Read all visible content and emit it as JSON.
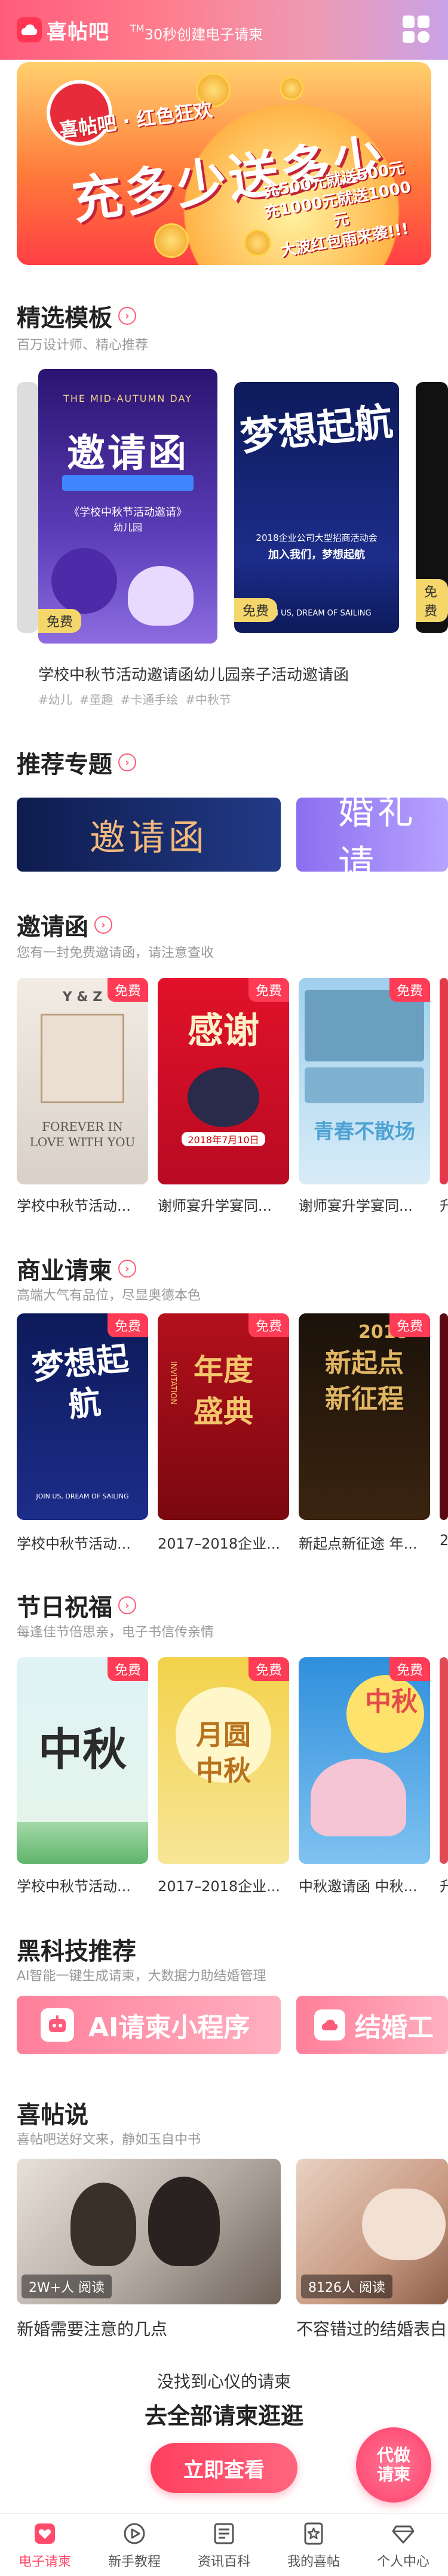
{
  "header": {
    "app_name": "喜帖吧",
    "slogan": "30秒创建电子请柬"
  },
  "banner": {
    "small_title": "喜帖吧 · 红色狂欢",
    "big_title": "充多少送多少",
    "promo_lines": [
      "充500元就送500元",
      "充1000元就送1000元",
      "大波红包雨来袭!!!"
    ]
  },
  "featured": {
    "title": "精选模板",
    "subtitle": "百万设计师、精心推荐",
    "free_label": "免费",
    "card1": {
      "heading": "THE MID-AUTUMN DAY",
      "title": "邀请函",
      "line": "《学校中秋节活动邀请》",
      "small": "幼儿园"
    },
    "card2": {
      "title": "梦想起航",
      "line": "2018企业公司大型招商活动会",
      "small": "加入我们，梦想起航",
      "footer": "JOIN US, DREAM OF SAILING"
    },
    "caption": "学校中秋节活动邀请函幼儿园亲子活动邀请函",
    "tags": [
      "#幼儿",
      "#童趣",
      "#卡通手绘",
      "#中秋节"
    ]
  },
  "topics": {
    "title": "推荐专题",
    "items": [
      "邀请函",
      "婚礼请"
    ]
  },
  "invitations": {
    "title": "邀请函",
    "subtitle": "您有一封免费邀请函，请注意查收",
    "free_label": "免费",
    "cards": [
      {
        "caption": "学校中秋节活动...",
        "art": "FOREVER IN LOVE WITH YOU",
        "top": "Y & Z"
      },
      {
        "caption": "谢师宴升学宴同...",
        "art": "感谢",
        "date": "2018年7月10日"
      },
      {
        "caption": "谢师宴升学宴同...",
        "art": "青春不散场"
      },
      {
        "caption": "升"
      }
    ]
  },
  "business": {
    "title": "商业请柬",
    "subtitle": "高端大气有品位，尽显奥德本色",
    "free_label": "免费",
    "cards": [
      {
        "caption": "学校中秋节活动...",
        "art": "梦想起航",
        "footer": "JOIN US, DREAM OF SAILING"
      },
      {
        "caption": "2017–2018企业...",
        "art": "年度盛典",
        "side": "INVITATION"
      },
      {
        "caption": "新起点新征途 年...",
        "art": "新起点新征程",
        "year": "2018"
      },
      {
        "caption": "2"
      }
    ]
  },
  "festival": {
    "title": "节日祝福",
    "subtitle": "每逢佳节倍思亲，电子书信传亲情",
    "free_label": "免费",
    "cards": [
      {
        "caption": "学校中秋节活动...",
        "art": "中秋"
      },
      {
        "caption": "2017–2018企业...",
        "art": "月圆中秋"
      },
      {
        "caption": "中秋邀请函 中秋...",
        "art": "中秋"
      },
      {
        "caption": "升"
      }
    ]
  },
  "tech": {
    "title": "黑科技推荐",
    "subtitle": "AI智能一键生成请柬，大数据力助结婚管理",
    "items": [
      "AI请柬小程序",
      "结婚工"
    ]
  },
  "articles": {
    "title": "喜帖说",
    "subtitle": "喜帖吧送好文来，静如玉自中书",
    "items": [
      {
        "views": "2W+人 阅读",
        "title": "新婚需要注意的几点"
      },
      {
        "views": "8126人 阅读",
        "title": "不容错过的结婚表白"
      }
    ]
  },
  "footer": {
    "no_match": "没找到心仪的请柬",
    "browse": "去全部请柬逛逛",
    "button": "立即查看",
    "float_button": "代做请柬"
  },
  "tabbar": {
    "items": [
      {
        "label": "电子请柬",
        "icon": "heart-card-icon"
      },
      {
        "label": "新手教程",
        "icon": "play-icon"
      },
      {
        "label": "资讯百科",
        "icon": "news-icon"
      },
      {
        "label": "我的喜帖",
        "icon": "star-card-icon"
      },
      {
        "label": "个人中心",
        "icon": "diamond-icon"
      }
    ]
  },
  "colors": {
    "accent": "#ff4b6b",
    "header_start": "#ff5c7c",
    "header_end": "#c9a2e8"
  }
}
